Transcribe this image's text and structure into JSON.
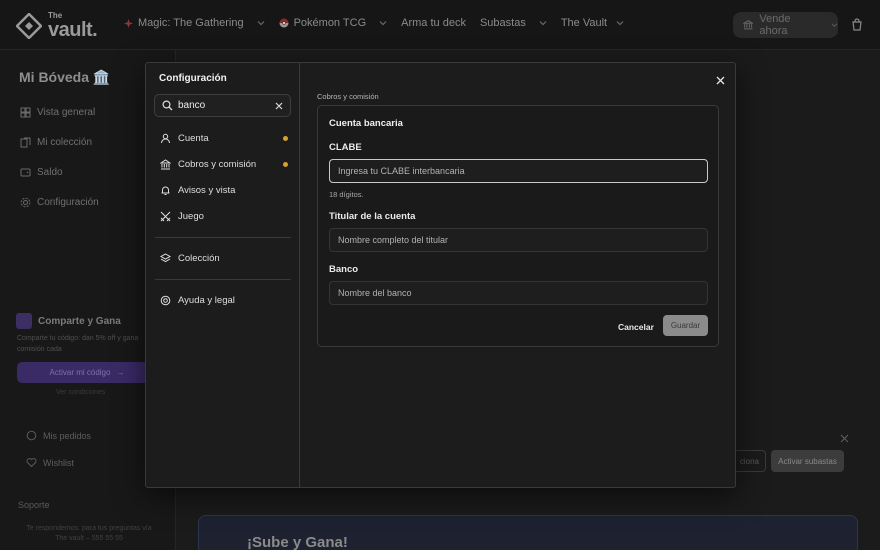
{
  "header": {
    "logo_small": "The",
    "logo_large": "vault.",
    "nav": [
      "Magic: The Gathering",
      "Pokémon TCG",
      "Arma tu deck",
      "Subastas",
      "The Vault"
    ],
    "vender_label": "Vende ahora",
    "cart_icon": "cart-icon"
  },
  "sidebar": {
    "title": "Mi Bóveda 🏛️",
    "items": [
      "Vista general",
      "Mi colección",
      "Saldo",
      "Configuración"
    ],
    "promo": {
      "title": "Comparte y Gana",
      "text": "Comparte tu código: dan 5% off y gana comisión cada",
      "button": "Activar mi código",
      "foot": "Ver condiciones"
    },
    "links": [
      "Mis pedidos",
      "Wishlist"
    ],
    "support": {
      "title": "Soporte",
      "text": "Te respondemos. para tus preguntas vía The vault – 555 55 55"
    }
  },
  "background": {
    "banner_btn1": "ciona",
    "banner_btn2": "Activar subastas",
    "sube_title": "¡Sube y Gana!"
  },
  "modal": {
    "title": "Configuración",
    "search_value": "banco",
    "nav": [
      {
        "label": "Cuenta",
        "dot": true
      },
      {
        "label": "Cobros y comisión",
        "dot": true
      },
      {
        "label": "Avisos y vista",
        "dot": false
      },
      {
        "label": "Juego",
        "dot": false
      },
      {
        "label": "Colección",
        "dot": false
      },
      {
        "label": "Ayuda y legal",
        "dot": false
      }
    ],
    "breadcrumb": "Cobros y comisión",
    "card_title": "Cuenta bancaria",
    "clabe_label": "CLABE",
    "clabe_placeholder": "Ingresa tu CLABE interbancaria",
    "clabe_hint": "18 dígitos.",
    "titular_label": "Titular de la cuenta",
    "titular_placeholder": "Nombre completo del titular",
    "banco_label": "Banco",
    "banco_placeholder": "Nombre del banco",
    "cancel_label": "Cancelar",
    "save_label": "Guardar",
    "dot_color": "#d9a030"
  }
}
